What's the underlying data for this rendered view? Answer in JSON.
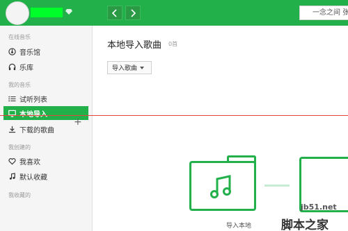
{
  "colors": {
    "accent": "#22b04a",
    "username_highlight": "#00ff2a",
    "guide_line": "#e7433b"
  },
  "header": {
    "search_text": "一念之间 张杰"
  },
  "sidebar": {
    "sections": [
      {
        "label": "在线音乐"
      },
      {
        "label": "我的音乐"
      },
      {
        "label": "我创建的"
      },
      {
        "label": "我收藏的"
      }
    ],
    "items": [
      {
        "label": "音乐馆",
        "icon": "disc-icon"
      },
      {
        "label": "乐库",
        "icon": "headphones-icon"
      },
      {
        "label": "试听列表",
        "icon": "list-icon"
      },
      {
        "label": "本地导入",
        "icon": "monitor-icon",
        "active": true
      },
      {
        "label": "下载的歌曲",
        "icon": "download-icon"
      },
      {
        "label": "我喜欢",
        "icon": "heart-icon"
      },
      {
        "label": "默认收藏",
        "icon": "music-note-icon"
      }
    ]
  },
  "main": {
    "title": "本地导入歌曲",
    "count": "0首",
    "import_button": "导入歌曲",
    "illustration_caption": "导入本地"
  },
  "watermark": {
    "site": "jb51.net",
    "name": "脚本之家"
  }
}
